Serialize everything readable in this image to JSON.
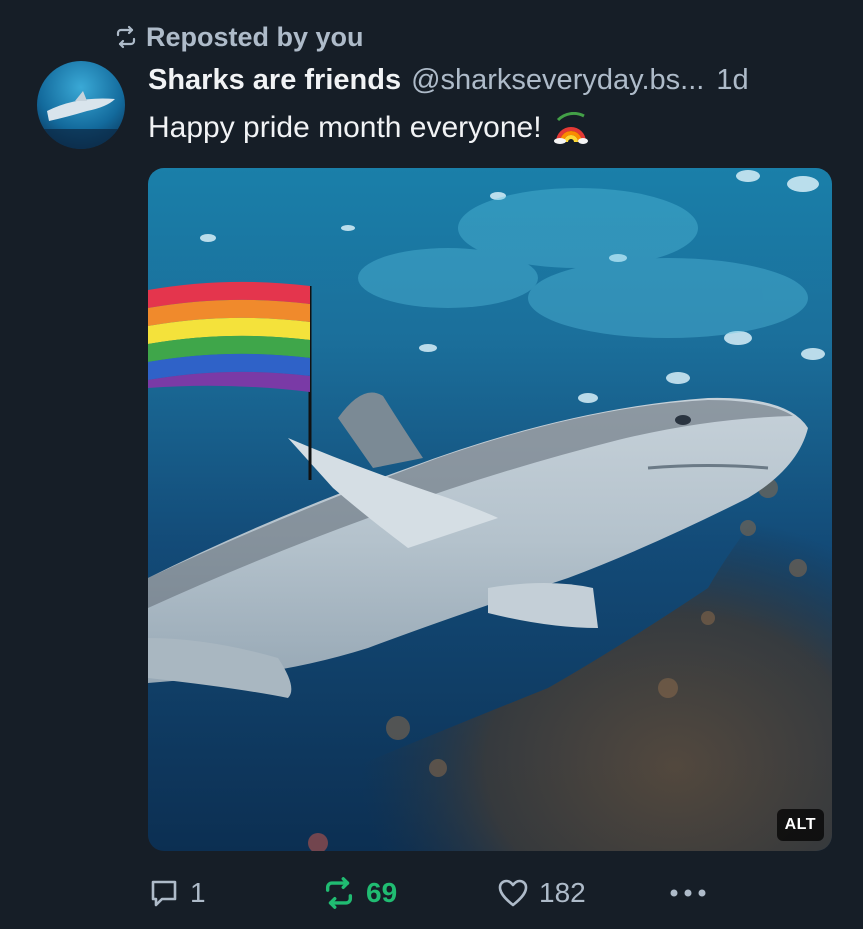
{
  "repost_banner": {
    "icon": "repost-icon",
    "text": "Reposted by you"
  },
  "post": {
    "author": {
      "display_name": "Sharks are friends",
      "handle": "@sharkseveryday.bs...",
      "avatar_icon": "shark-avatar"
    },
    "separator": "",
    "time": "1d",
    "text": "Happy pride month everyone!",
    "text_emoji": "rainbow-emoji",
    "media": {
      "description_icon": "shark-with-pride-flag-photo",
      "alt_badge": "ALT"
    },
    "actions": {
      "reply": {
        "icon": "reply-icon",
        "count": "1"
      },
      "repost": {
        "icon": "repost-icon",
        "count": "69",
        "active": true,
        "color": "#20bc72"
      },
      "like": {
        "icon": "heart-icon",
        "count": "182"
      },
      "more": {
        "icon": "more-dots-icon"
      }
    }
  },
  "colors": {
    "background": "#161e27",
    "text_primary": "#f1f3f5",
    "text_secondary": "#aebbc9",
    "repost_active": "#20bc72"
  }
}
